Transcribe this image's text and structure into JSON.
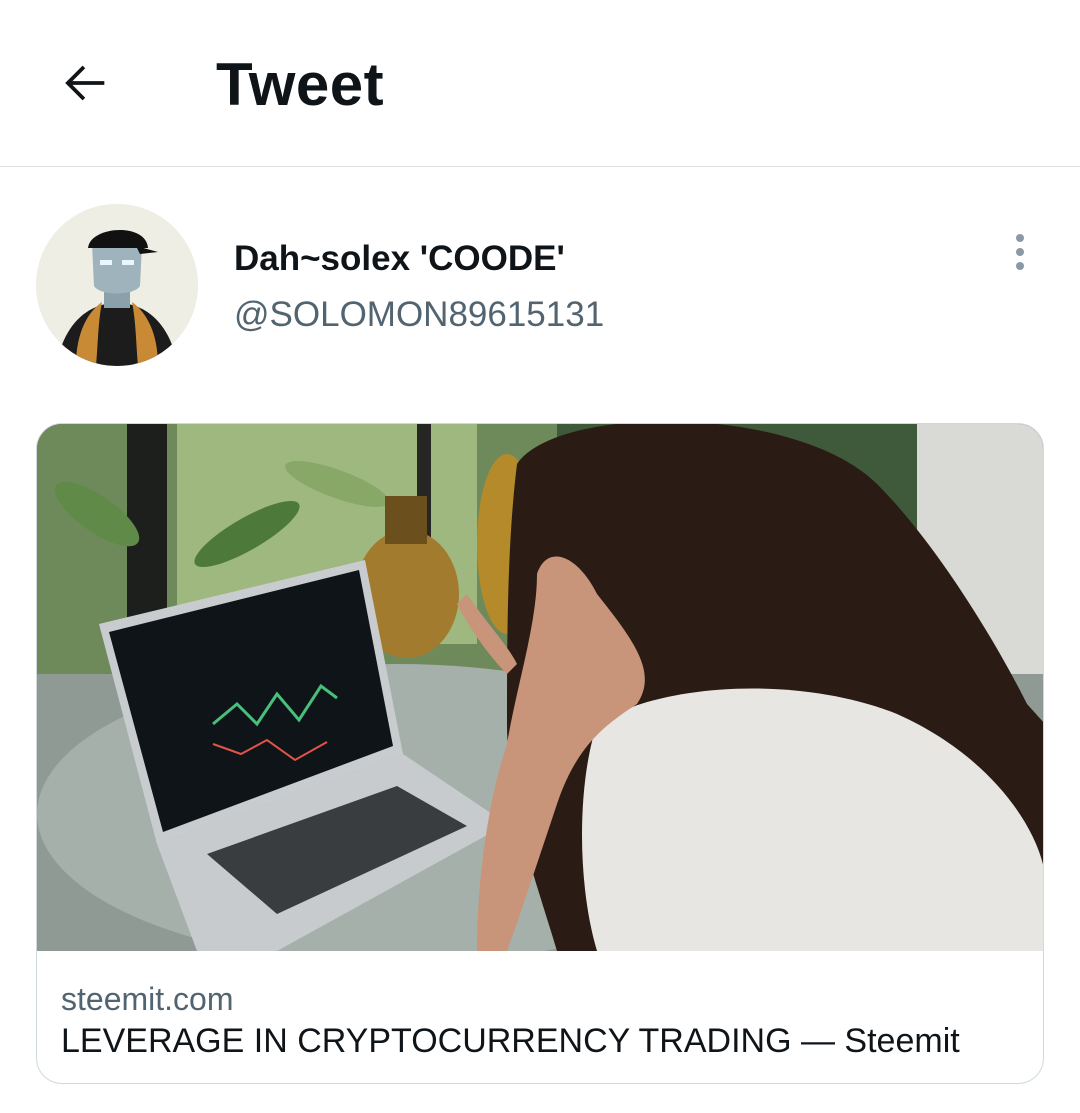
{
  "header": {
    "back_icon": "arrow-left-icon",
    "title": "Tweet"
  },
  "author": {
    "display_name": "Dah~solex 'COODE'",
    "handle": "@SOLOMON89615131",
    "more_icon": "more-vertical-icon"
  },
  "link_card": {
    "domain": "steemit.com",
    "title": "LEVERAGE IN CRYPTOCURRENCY TRADING — Steemit"
  },
  "colors": {
    "text_primary": "#0f1419",
    "text_secondary": "#536471",
    "border": "#cfd9de"
  }
}
